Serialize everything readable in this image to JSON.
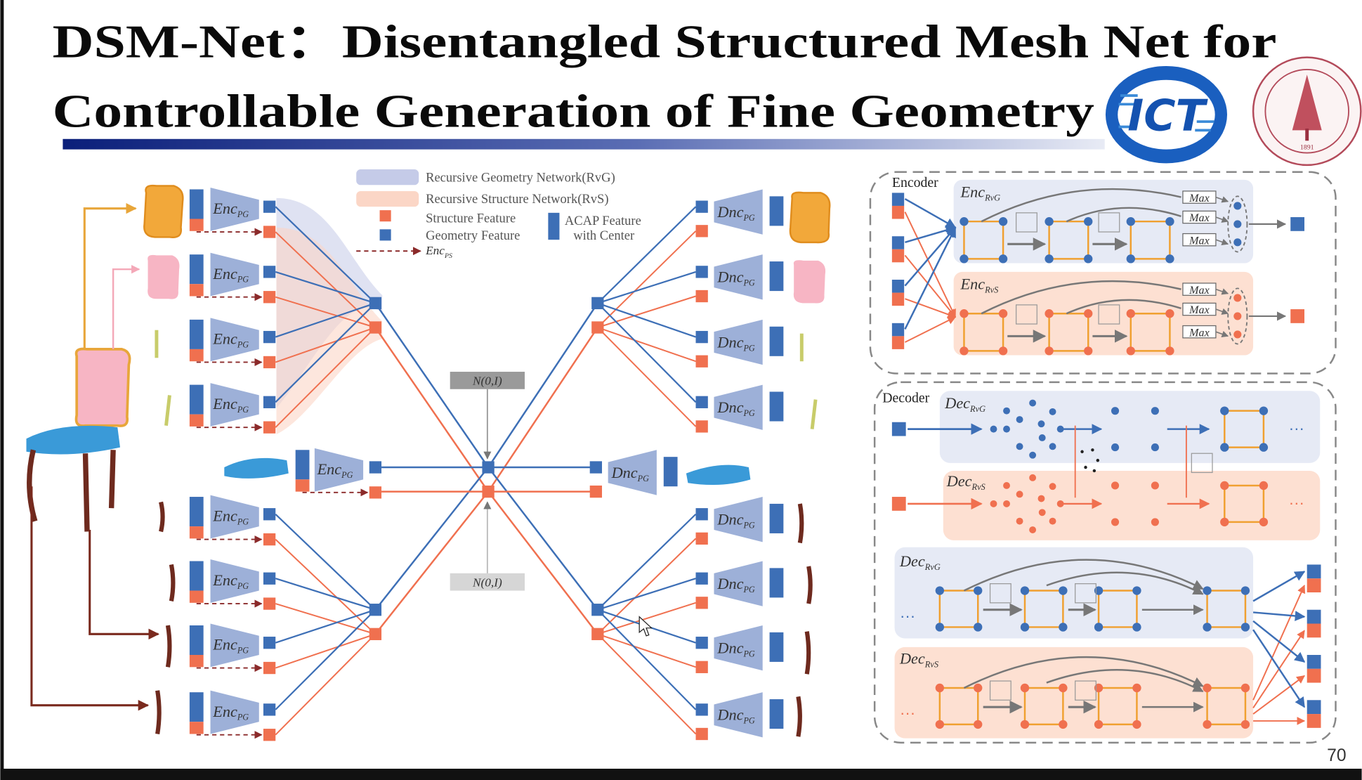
{
  "slide": {
    "title_line1": "DSM-Net：Disentangled Structured Mesh Net for",
    "title_line2": "Controllable Generation of Fine Geometry",
    "page_number": "70"
  },
  "logos": {
    "ict": "ICT",
    "stanford": "LELAND STANFORD JUNIOR UNIVERSITY",
    "stanford_year": "1891"
  },
  "legend": {
    "rvg": "Recursive Geometry Network(RvG)",
    "rvs": "Recursive Structure Network(RvS)",
    "structure_feature": "Structure Feature",
    "geometry_feature": "Geometry Feature",
    "acap_line1": "ACAP Feature",
    "acap_line2": "with Center",
    "enc_ps_main": "Enc",
    "enc_ps_sub": "PS"
  },
  "pipeline": {
    "enc_main": "Enc",
    "enc_sub": "PG",
    "dnc_main": "Dnc",
    "dnc_sub": "PG",
    "noise_label": "N(0,I)"
  },
  "encoder_panel": {
    "title": "Encoder",
    "main": "Enc",
    "rvg_sub": "RvG",
    "rvs_sub": "RvS",
    "max_label": "Max"
  },
  "decoder_panel": {
    "title": "Decoder",
    "main": "Dec",
    "rvg_sub": "RvG",
    "rvs_sub": "RvS",
    "ellipsis": "···"
  },
  "colors": {
    "blue": "#3d6fb6",
    "orange": "#f0704f",
    "edge": "#f0a030",
    "blue_band": "#e6eaf5",
    "orange_band": "#fde0d2",
    "grey": "#777777"
  }
}
